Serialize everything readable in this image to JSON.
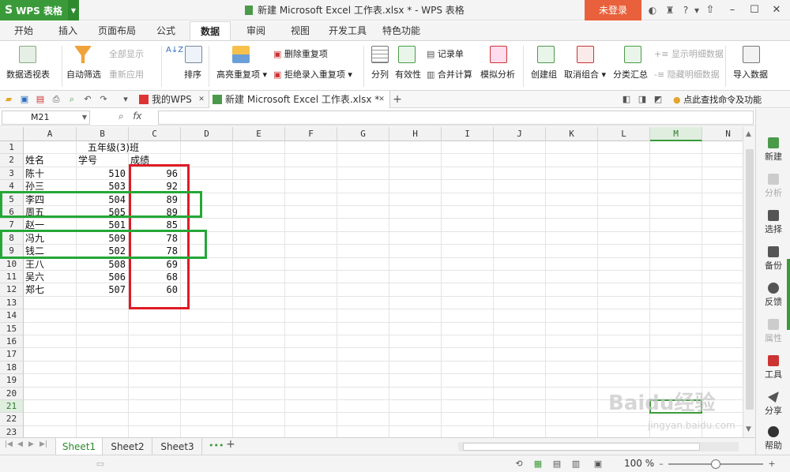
{
  "app": {
    "name": "WPS 表格",
    "logo_letter": "S",
    "window_title": "新建 Microsoft Excel 工作表.xlsx * - WPS 表格",
    "login_label": "未登录"
  },
  "ribbon_tabs": [
    "开始",
    "插入",
    "页面布局",
    "公式",
    "数据",
    "审阅",
    "视图",
    "开发工具",
    "特色功能"
  ],
  "ribbon": {
    "pivot": "数据透视表",
    "autofilter": "自动筛选",
    "show_all": "全部显示",
    "reapply": "重新应用",
    "sort": "排序",
    "highlight_dup": "高亮重复项",
    "remove_dup": "删除重复项",
    "reject_dup": "拒绝录入重复项",
    "split": "分列",
    "validity": "有效性",
    "form": "记录单",
    "consolidate": "合并计算",
    "whatif": "模拟分析",
    "group": "创建组",
    "ungroup": "取消组合",
    "subtotal": "分类汇总",
    "show_detail": "显示明细数据",
    "hide_detail": "隐藏明细数据",
    "import": "导入数据"
  },
  "doc_tabs": {
    "home_tab": "我的WPS",
    "file_tab": "新建 Microsoft Excel 工作表.xlsx *",
    "find_cmd": "点此查找命令及功能"
  },
  "formula_bar": {
    "name_box": "M21",
    "fx_label": "fx",
    "formula": ""
  },
  "columns": [
    "A",
    "B",
    "C",
    "D",
    "E",
    "F",
    "G",
    "H",
    "I",
    "J",
    "K",
    "L",
    "M",
    "N"
  ],
  "selected_column": "M",
  "rows": [
    "1",
    "2",
    "3",
    "4",
    "5",
    "6",
    "7",
    "8",
    "9",
    "10",
    "11",
    "12",
    "13",
    "14",
    "15",
    "16",
    "17",
    "18",
    "19",
    "20",
    "21",
    "22",
    "23"
  ],
  "selected_row": "21",
  "sheet": {
    "title": "五年级(3)班",
    "headers": [
      "姓名",
      "学号",
      "成绩"
    ],
    "records": [
      {
        "name": "陈十",
        "id": "510",
        "score": "96"
      },
      {
        "name": "孙三",
        "id": "503",
        "score": "92"
      },
      {
        "name": "李四",
        "id": "504",
        "score": "89"
      },
      {
        "name": "周五",
        "id": "505",
        "score": "89"
      },
      {
        "name": "赵一",
        "id": "501",
        "score": "85"
      },
      {
        "name": "冯九",
        "id": "509",
        "score": "78"
      },
      {
        "name": "钱二",
        "id": "502",
        "score": "78"
      },
      {
        "name": "王八",
        "id": "508",
        "score": "69"
      },
      {
        "name": "吴六",
        "id": "506",
        "score": "68"
      },
      {
        "name": "郑七",
        "id": "507",
        "score": "60"
      }
    ]
  },
  "side_panel": [
    "新建",
    "分析",
    "选择",
    "备份",
    "反馈",
    "属性",
    "工具",
    "分享",
    "帮助"
  ],
  "sheet_tabs": [
    "Sheet1",
    "Sheet2",
    "Sheet3"
  ],
  "active_sheet": "Sheet1",
  "status": {
    "zoom": "100 %"
  },
  "watermark": {
    "brand": "Baidu经验",
    "url": "jingyan.baidu.com"
  },
  "colors": {
    "wps_green": "#3a9a3a",
    "login_orange": "#e8613c",
    "annotation_red": "#e01b24",
    "annotation_green": "#25a737"
  }
}
